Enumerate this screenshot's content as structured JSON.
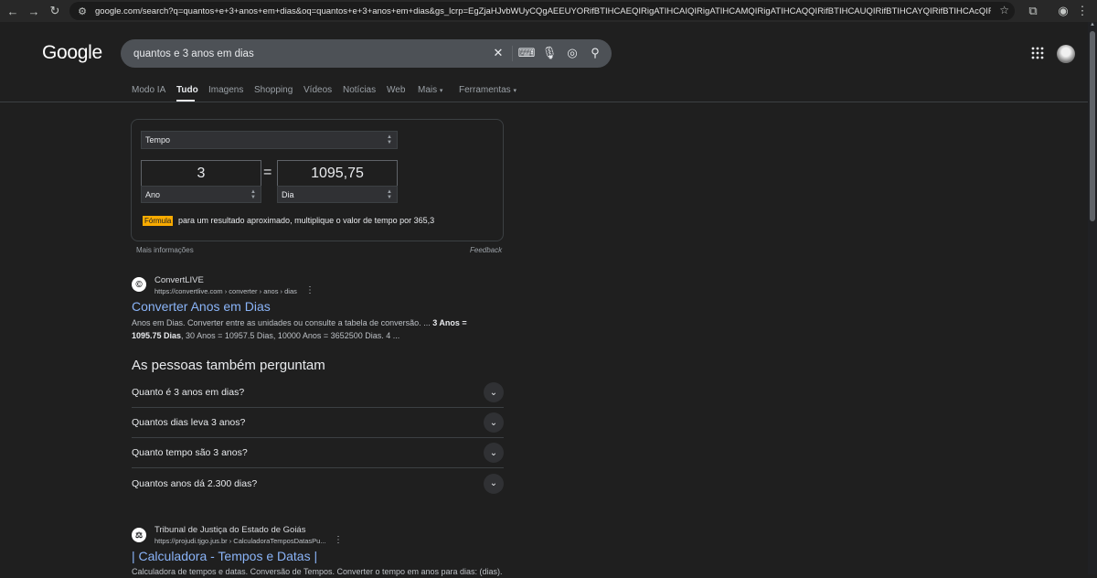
{
  "browser": {
    "url_host": "google.com",
    "url_rest": "/search?q=quantos+e+3+anos+em+dias&oq=quantos+e+3+anos+em+dias&gs_lcrp=EgZjaHJvbWUyCQgAEEUYORifBTIHCAEQIRigATIHCAIQIRigATIHCAMQIRigATIHCAQQIRifBTIHCAUQIRifBTIHCAYQIRifBTIHCAcQIRifBTIHCAgQIRifBTIHCAkQI..."
  },
  "logo": "Google",
  "search": {
    "query": "quantos e 3 anos em dias"
  },
  "tabs": [
    "Modo IA",
    "Tudo",
    "Imagens",
    "Shopping",
    "Vídeos",
    "Notícias",
    "Web",
    "Mais",
    "Ferramentas"
  ],
  "converter": {
    "category": "Tempo",
    "from_value": "3",
    "to_value": "1095,75",
    "from_unit": "Ano",
    "to_unit": "Dia",
    "formula_label": "Fórmula",
    "formula_text": "para um resultado aproximado, multiplique o valor de tempo por 365,3",
    "more_info": "Mais informações",
    "feedback": "Feedback"
  },
  "result1": {
    "site": "ConvertLIVE",
    "url": "https://convertlive.com › converter › anos › dias",
    "title": "Converter Anos em Dias",
    "snippet_a": "Anos em Dias. Converter entre as unidades ou consulte a tabela de conversão. ... ",
    "snippet_b": "3 Anos = 1095.75 Dias",
    "snippet_c": ", 30 Anos = 10957.5 Dias, 10000 Anos = 3652500 Dias. 4 ..."
  },
  "paa": {
    "title": "As pessoas também perguntam",
    "items": [
      "Quanto é 3 anos em dias?",
      "Quantos dias leva 3 anos?",
      "Quanto tempo são 3 anos?",
      "Quantos anos dá 2.300 dias?"
    ]
  },
  "result2": {
    "site": "Tribunal de Justiça do Estado de Goiás",
    "url": "https://projudi.tjgo.jus.br › CalculadoraTemposDatasPu...",
    "title": "| Calculadora - Tempos e Datas |",
    "snippet": "Calculadora de tempos e datas. Conversão de Tempos. Converter o tempo em anos para dias: (dias)."
  }
}
